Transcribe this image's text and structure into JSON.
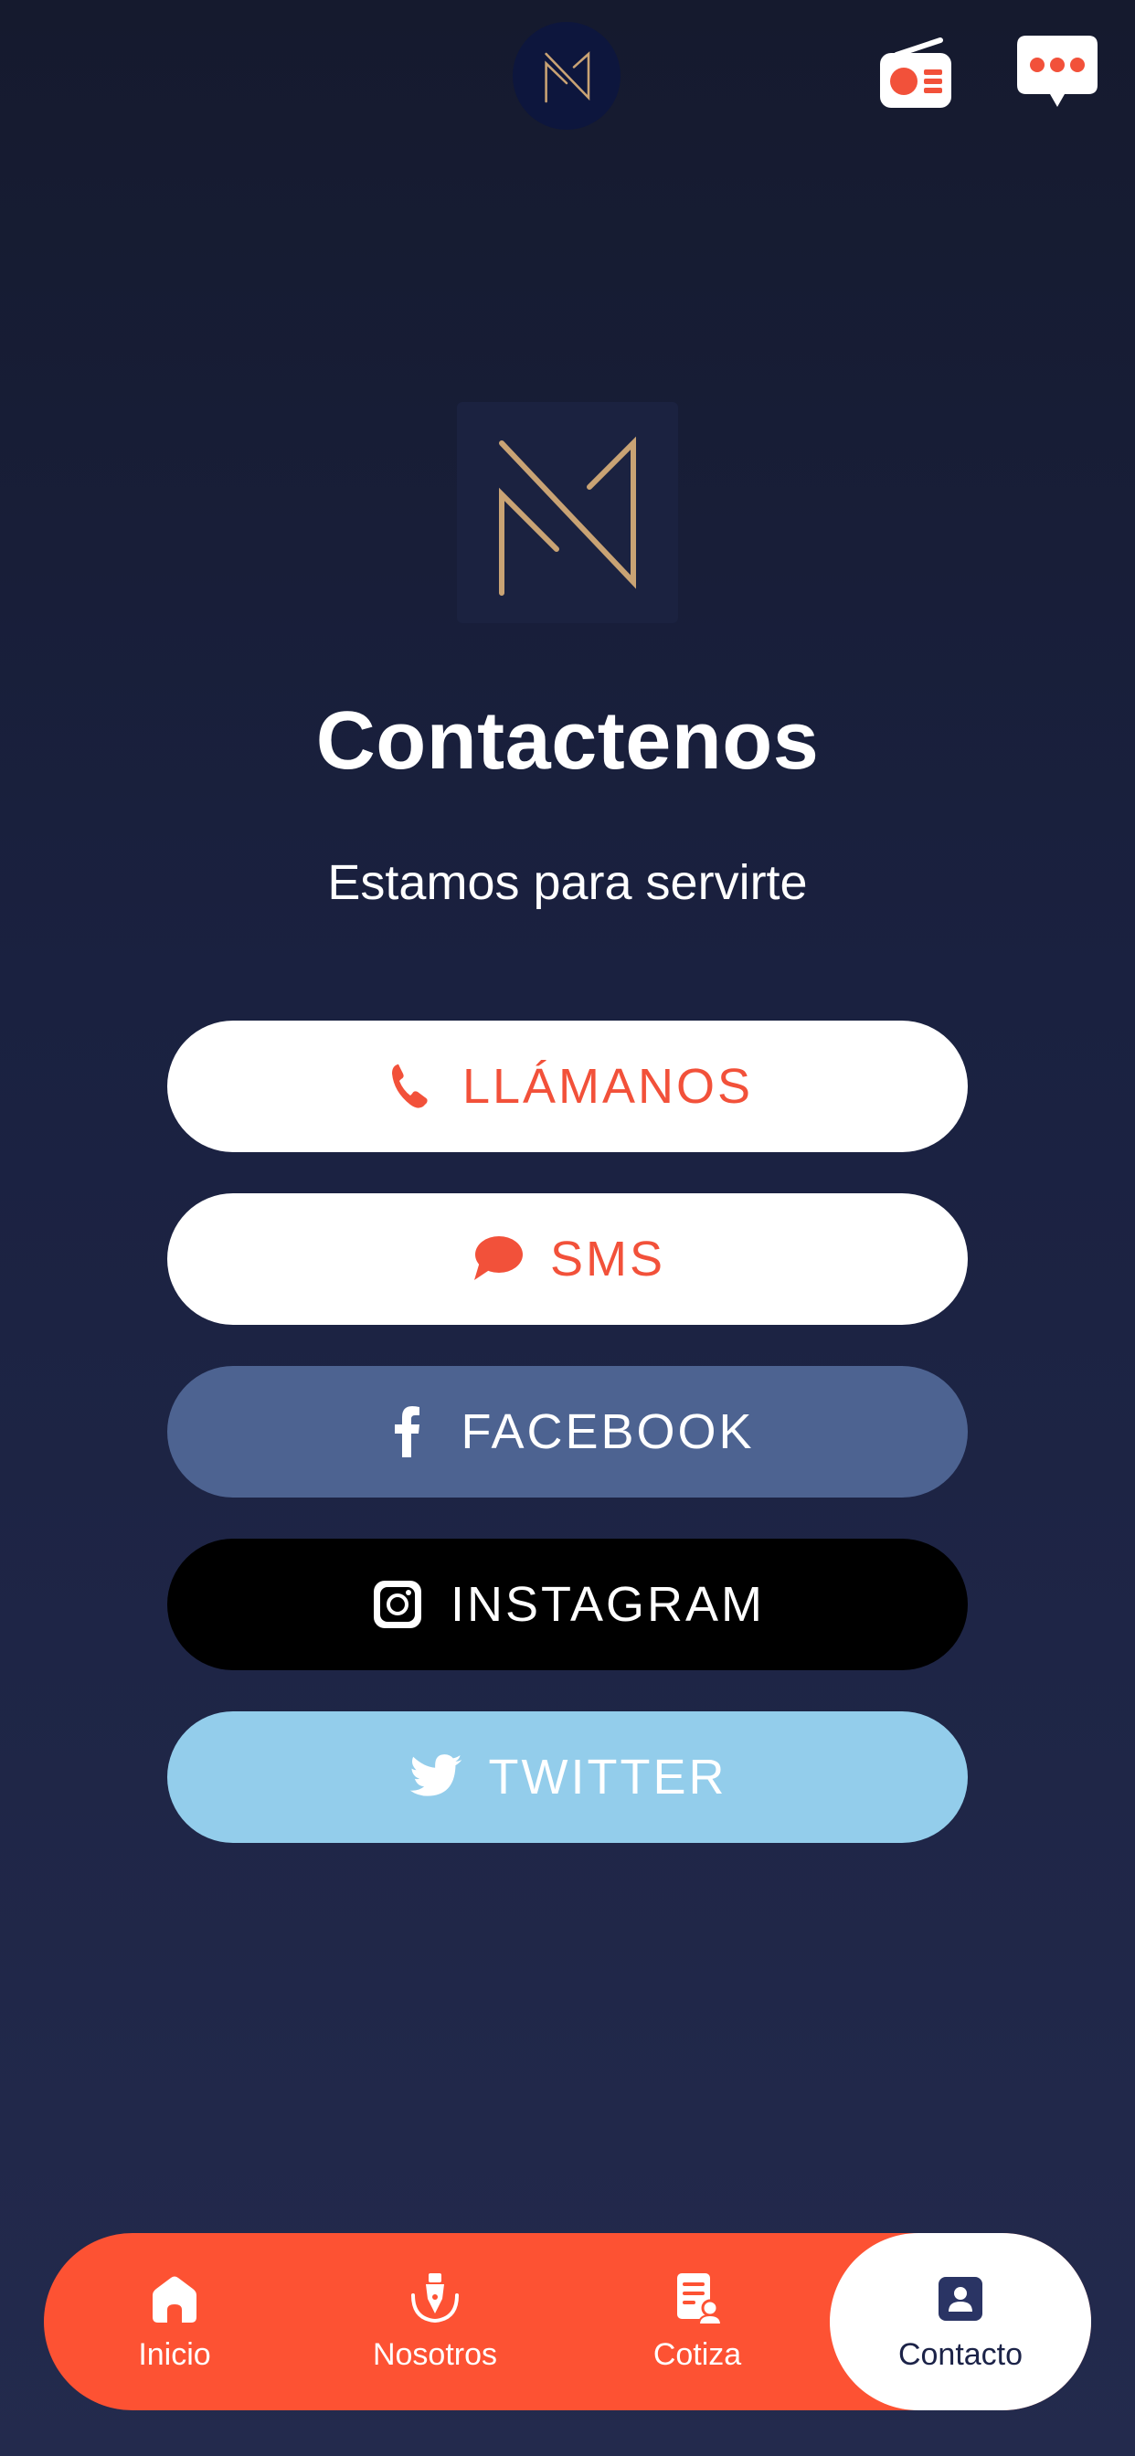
{
  "header": {
    "logo_icon": "brand-logo-icon",
    "radio_icon": "radio-icon",
    "chat_icon": "chat-bubble-icon"
  },
  "main": {
    "title": "Contactenos",
    "subtitle": "Estamos para servirte"
  },
  "contact_buttons": [
    {
      "label": "LLÁMANOS",
      "icon": "phone-icon"
    },
    {
      "label": "SMS",
      "icon": "speech-bubble-icon"
    },
    {
      "label": "FACEBOOK",
      "icon": "facebook-icon"
    },
    {
      "label": "INSTAGRAM",
      "icon": "instagram-icon"
    },
    {
      "label": "TWITTER",
      "icon": "twitter-icon"
    }
  ],
  "bottom_nav": [
    {
      "label": "Inicio",
      "icon": "home-icon"
    },
    {
      "label": "Nosotros",
      "icon": "pen-nib-icon"
    },
    {
      "label": "Cotiza",
      "icon": "quote-document-icon"
    },
    {
      "label": "Contacto",
      "icon": "contact-card-icon",
      "active": true
    }
  ],
  "colors": {
    "accent": "#fd5233",
    "background_top": "#151a2e",
    "background_bottom": "#232a4d",
    "logo_gold": "#c9a374",
    "facebook": "#4d6391",
    "instagram": "#000000",
    "twitter": "#93cdeb"
  }
}
